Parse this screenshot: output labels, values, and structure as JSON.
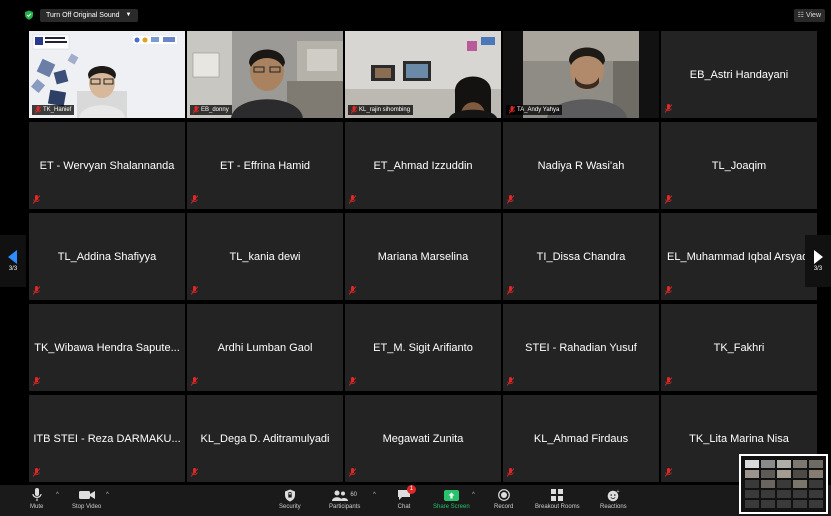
{
  "topbar": {
    "original_sound_label": "Turn Off Original Sound",
    "view_label": "View",
    "shield_icon": "shield-icon",
    "colors": {
      "shield": "#23b14d"
    }
  },
  "participants": [
    {
      "name": "TK_Hanief",
      "video": true,
      "muted": true
    },
    {
      "name": "EB_donny",
      "video": true,
      "muted": true
    },
    {
      "name": "KL_rajin sihombing",
      "video": true,
      "muted": true
    },
    {
      "name": "TA_Andy Yahya",
      "video": true,
      "muted": true
    },
    {
      "name": "EB_Astri Handayani",
      "video": false,
      "muted": true
    },
    {
      "name": "ET - Wervyan Shalannanda",
      "video": false,
      "muted": true
    },
    {
      "name": "ET - Effrina Hamid",
      "video": false,
      "muted": true
    },
    {
      "name": "ET_Ahmad Izzuddin",
      "video": false,
      "muted": true
    },
    {
      "name": "Nadiya R Wasi'ah",
      "video": false,
      "muted": true
    },
    {
      "name": "TL_Joaqim",
      "video": false,
      "muted": true
    },
    {
      "name": "TL_Addina Shafiyya",
      "video": false,
      "muted": true
    },
    {
      "name": "TL_kania dewi",
      "video": false,
      "muted": true
    },
    {
      "name": "Mariana Marselina",
      "video": false,
      "muted": true
    },
    {
      "name": "TI_Dissa Chandra",
      "video": false,
      "muted": true
    },
    {
      "name": "EL_Muhammad Iqbal Arsyad",
      "video": false,
      "muted": true
    },
    {
      "name": "TK_Wibawa Hendra Sapute...",
      "video": false,
      "muted": true
    },
    {
      "name": "Ardhi Lumban Gaol",
      "video": false,
      "muted": true
    },
    {
      "name": "ET_M. Sigit Arifianto",
      "video": false,
      "muted": true
    },
    {
      "name": "STEI - Rahadian Yusuf",
      "video": false,
      "muted": true
    },
    {
      "name": "TK_Fakhri",
      "video": false,
      "muted": true
    },
    {
      "name": "ITB STEI - Reza DARMAKU...",
      "video": false,
      "muted": true
    },
    {
      "name": "KL_Dega D. Aditramulyadi",
      "video": false,
      "muted": true
    },
    {
      "name": "Megawati Zunita",
      "video": false,
      "muted": true
    },
    {
      "name": "KL_Ahmad Firdaus",
      "video": false,
      "muted": true
    },
    {
      "name": "TK_Lita Marina Nisa",
      "video": false,
      "muted": true
    }
  ],
  "pagination": {
    "left": "3/3",
    "right": "3/3"
  },
  "toolbar": {
    "mute": "Mute",
    "stop_video": "Stop Video",
    "security": "Security",
    "participants": "Participants",
    "participants_count": "60",
    "chat": "Chat",
    "chat_badge": "1",
    "share_screen": "Share Screen",
    "record": "Record",
    "breakout_rooms": "Breakout Rooms",
    "reactions": "Reactions",
    "colors": {
      "share": "#27c26b",
      "badge": "#e02828",
      "muted_mic": "#e02828"
    }
  }
}
